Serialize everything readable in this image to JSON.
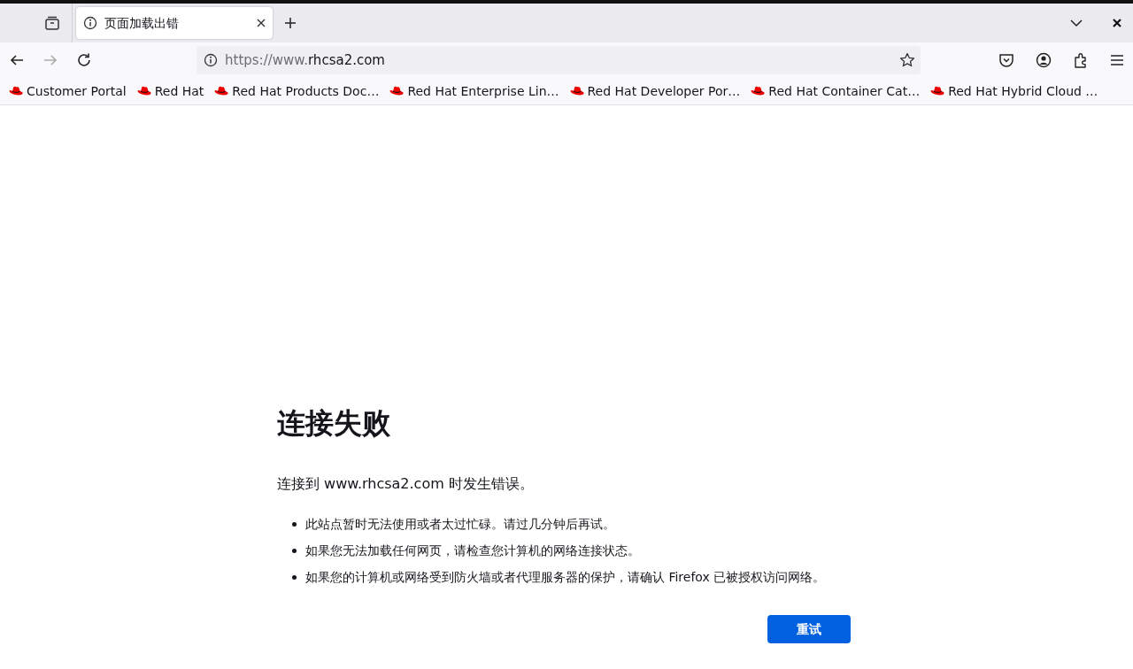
{
  "tabs": [
    {
      "title": "页面加载出错",
      "selected": true
    }
  ],
  "address_bar": {
    "url_prefix": "https://www.",
    "url_host": "rhcsa2.com"
  },
  "nav": {
    "back_disabled": false,
    "forward_disabled": true
  },
  "bookmarks": [
    {
      "label": "Customer Portal"
    },
    {
      "label": "Red Hat"
    },
    {
      "label": "Red Hat Products Doc…"
    },
    {
      "label": "Red Hat Enterprise Lin…"
    },
    {
      "label": "Red Hat Developer Por…"
    },
    {
      "label": "Red Hat Container Cat…"
    },
    {
      "label": "Red Hat Hybrid Cloud …"
    }
  ],
  "error_page": {
    "title": "连接失败",
    "message": "连接到 www.rhcsa2.com 时发生错误。",
    "bullets": [
      "此站点暂时无法使用或者太过忙碌。请过几分钟后再试。",
      "如果您无法加载任何网页，请检查您计算机的网络连接状态。",
      "如果您的计算机或网络受到防火墙或者代理服务器的保护，请确认 Firefox 已被授权访问网络。"
    ],
    "button": "重试"
  }
}
